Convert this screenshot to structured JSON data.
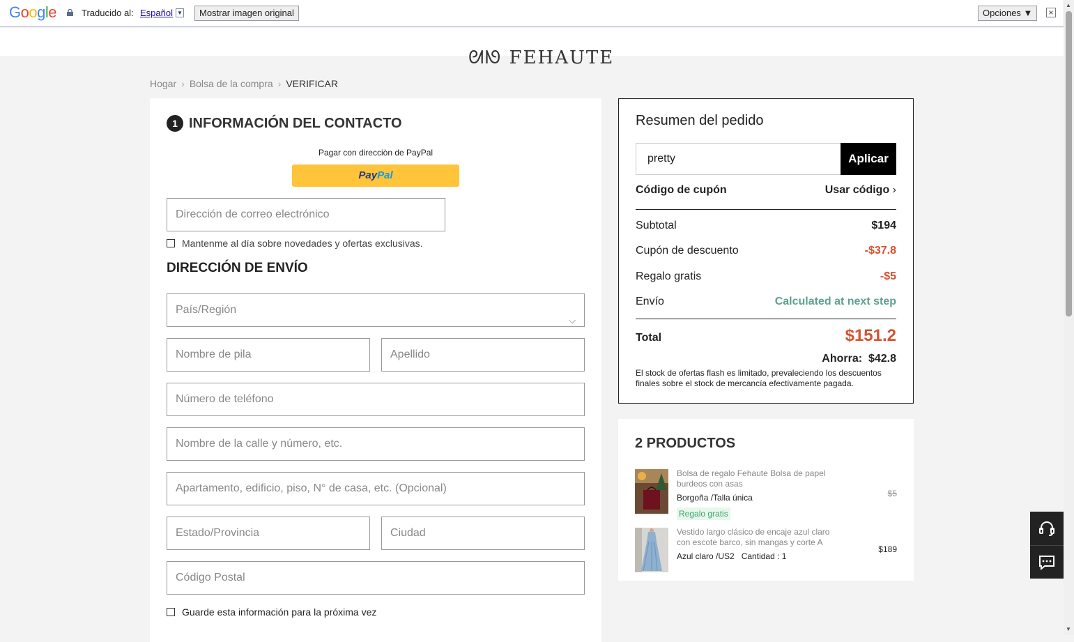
{
  "translate_bar": {
    "logo": "Google",
    "label": "Traducido al:",
    "language": "Español",
    "show_original": "Mostrar imagen original",
    "options": "Opciones ▼",
    "close": "×"
  },
  "site": {
    "logo": "FEHAUTE"
  },
  "breadcrumb": {
    "home": "Hogar",
    "bag": "Bolsa de la compra",
    "current": "VERIFICAR",
    "sep": "›"
  },
  "contact": {
    "step": "1",
    "title": "INFORMACIÓN DEL CONTACTO",
    "paypal_text": "Pagar con direcciòn de PayPal",
    "paypal_p1": "Pay",
    "paypal_p2": "Pal",
    "email_placeholder": "Dirección de correo electrónico",
    "newsletter": "Mantenme al día sobre novedades y ofertas exclusivas."
  },
  "shipping": {
    "title": "DIRECCIÓN DE ENVÍO",
    "country": "País/Región",
    "first_name": "Nombre de pila",
    "last_name": "Apellido",
    "phone": "Número de teléfono",
    "street": "Nombre de la calle y número, etc.",
    "apartment": "Apartamento, edificio, piso, N° de casa, etc. (Opcional)",
    "state": "Estado/Provincia",
    "city": "Ciudad",
    "zip": "Código Postal",
    "save": "Guarde esta información para la próxima vez"
  },
  "summary": {
    "title": "Resumen del pedido",
    "coupon_value": "pretty",
    "apply": "Aplicar",
    "coupon_label": "Código de cupón",
    "use_code": "Usar código",
    "subtotal_label": "Subtotal",
    "subtotal": "$194",
    "discount_label": "Cupón de descuento",
    "discount": "-$37.8",
    "gift_label": "Regalo gratis",
    "gift": "-$5",
    "shipping_label": "Envío",
    "shipping": "Calculated at next step",
    "total_label": "Total",
    "total": "$151.2",
    "save_label": "Ahorra:",
    "save": "$42.8",
    "note": "El stock de ofertas flash es limitado, prevaleciendo los descuentos finales sobre el stock de mercancía efectivamente pagada."
  },
  "products": {
    "title": "2 PRODUCTOS",
    "items": [
      {
        "name": "Bolsa de regalo Fehaute Bolsa de papel burdeos con asas",
        "variant": "Borgoña /Talla única",
        "price": "$5",
        "tag": "Regalo gratis"
      },
      {
        "name": "Vestido largo clásico de encaje azul claro con escote barco, sin mangas y corte A",
        "variant": "Azul claro /US2",
        "qty": "Cantidad : 1",
        "price": "$189"
      }
    ]
  }
}
